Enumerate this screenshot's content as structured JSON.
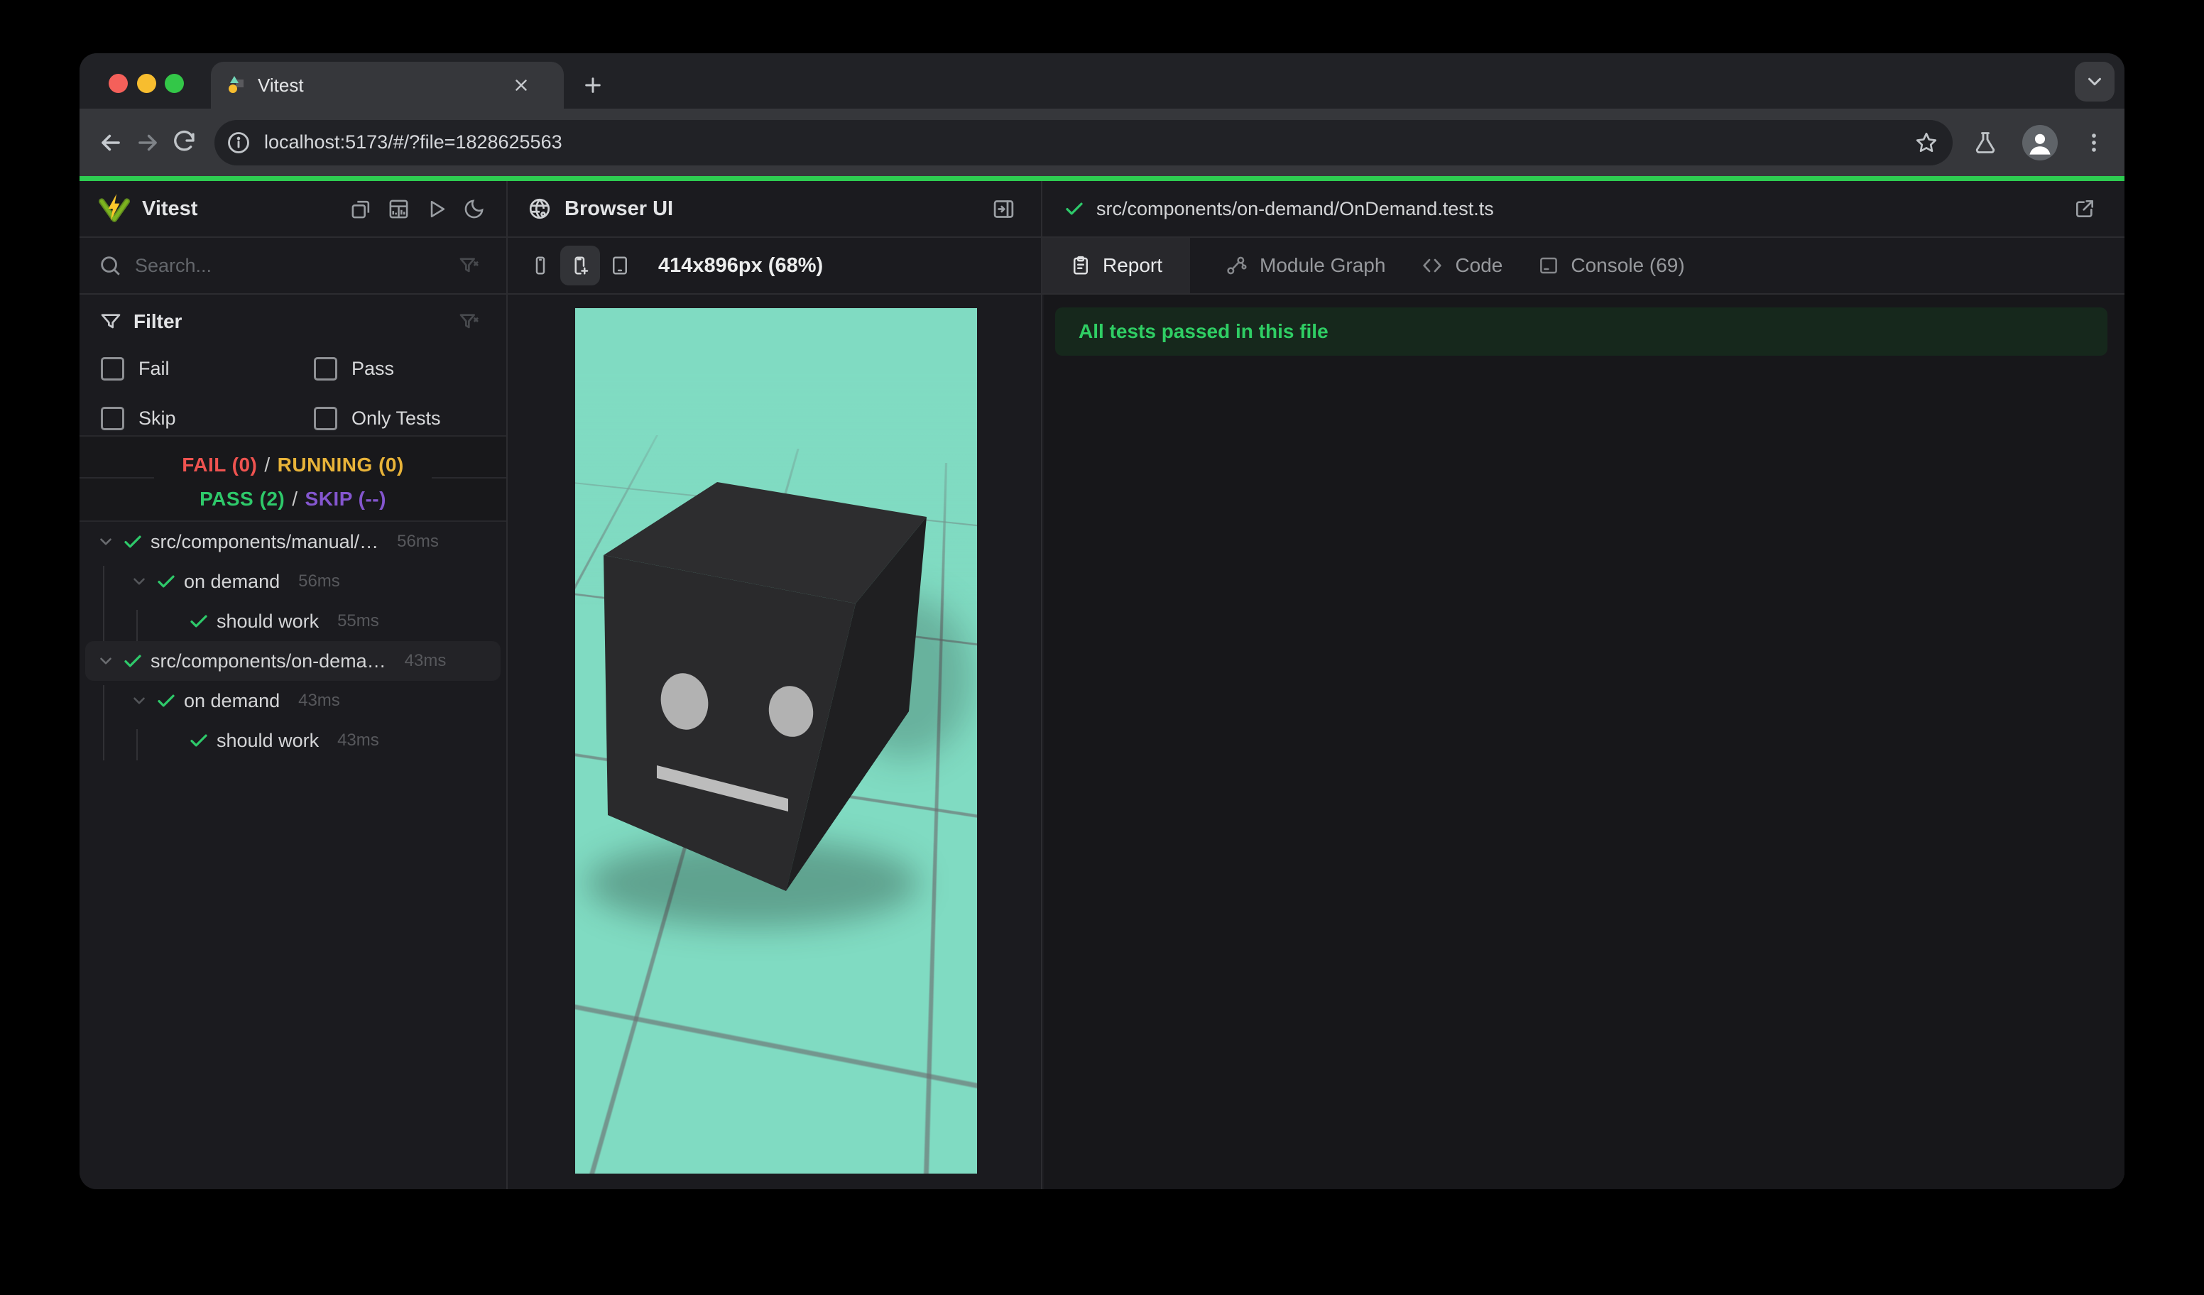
{
  "browser_chrome": {
    "tab_title": "Vitest",
    "url": "localhost:5173/#/?file=1828625563",
    "accent_green_bar": "#2ecc51"
  },
  "sidebar": {
    "app_title": "Vitest",
    "search_placeholder": "Search...",
    "filter_title": "Filter",
    "filter_options": [
      "Fail",
      "Pass",
      "Skip",
      "Only Tests"
    ],
    "stats": {
      "fail": "FAIL (0)",
      "running": "RUNNING (0)",
      "pass": "PASS (2)",
      "skip": "SKIP (--)",
      "separator": "/",
      "fail_color": "#ef5350",
      "running_color": "#e8b339",
      "pass_color": "#2ec96a",
      "skip_color": "#8456cf"
    },
    "tree": [
      {
        "label": "src/components/manual/…",
        "duration": "56ms"
      },
      {
        "label": "on demand",
        "duration": "56ms"
      },
      {
        "label": "should work",
        "duration": "55ms"
      },
      {
        "label": "src/components/on-dema…",
        "duration": "43ms"
      },
      {
        "label": "on demand",
        "duration": "43ms"
      },
      {
        "label": "should work",
        "duration": "43ms"
      }
    ]
  },
  "browser_panel": {
    "title": "Browser UI",
    "viewport_label": "414x896px (68%)",
    "viewport_background": "#80dbc2"
  },
  "report_panel": {
    "file_path": "src/components/on-demand/OnDemand.test.ts",
    "tabs": [
      "Report",
      "Module Graph",
      "Code",
      "Console (69)"
    ],
    "banner_text": "All tests passed in this file",
    "banner_text_color": "#2fce64"
  }
}
